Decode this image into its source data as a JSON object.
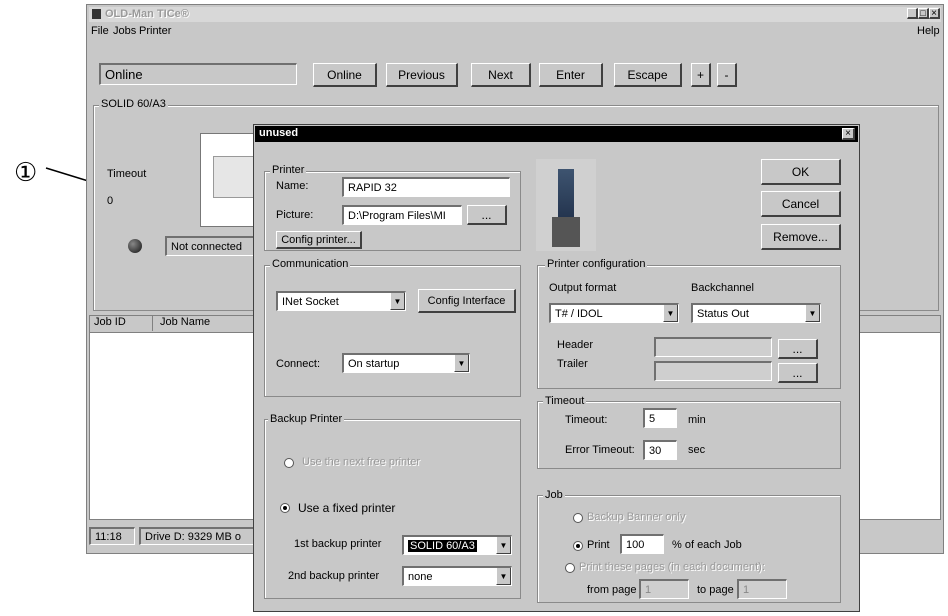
{
  "annotation": {
    "marker": "①"
  },
  "main_window": {
    "title": "OLD-Man TICe®",
    "controls": {
      "minimize": "_",
      "maximize": "□",
      "close": "×"
    },
    "menu": [
      "File",
      "Jobs",
      "Printer"
    ],
    "help_menu": "Help",
    "status_field": "Online",
    "toolbar": [
      "Online",
      "Previous",
      "Next",
      "Enter",
      "Escape",
      "+",
      "-"
    ],
    "printer_panel": {
      "title": "SOLID 60/A3",
      "timeout_label": "Timeout",
      "timeout_value": "0",
      "connection_status": "Not connected"
    },
    "job_list": {
      "columns": [
        "Job ID",
        "Job Name"
      ]
    },
    "statusbar": {
      "time": "11:18",
      "drive": "Drive D: 9329 MB o"
    }
  },
  "dialog": {
    "title": "unused",
    "close": "×",
    "printer_group": {
      "title": "Printer",
      "name_label": "Name:",
      "name_value": "RAPID 32",
      "picture_label": "Picture:",
      "picture_value": "D:\\Program Files\\MI",
      "browse": "...",
      "config_button": "Config printer..."
    },
    "buttons": {
      "ok": "OK",
      "cancel": "Cancel",
      "remove": "Remove..."
    },
    "communication_group": {
      "title": "Communication",
      "interface_value": "INet Socket",
      "config_button": "Config Interface",
      "connect_label": "Connect:",
      "connect_value": "On startup"
    },
    "printer_config_group": {
      "title": "Printer configuration",
      "output_format_label": "Output format",
      "output_format_value": "T# / IDOL",
      "backchannel_label": "Backchannel",
      "backchannel_value": "Status Out",
      "header_label": "Header",
      "trailer_label": "Trailer",
      "browse": "..."
    },
    "timeout_group": {
      "title": "Timeout",
      "timeout_label": "Timeout:",
      "timeout_value": "5",
      "timeout_unit": "min",
      "error_timeout_label": "Error Timeout:",
      "error_timeout_value": "30",
      "error_timeout_unit": "sec"
    },
    "backup_group": {
      "title": "Backup Printer",
      "option_next_free": "Use the next free printer",
      "option_fixed": "Use a fixed printer",
      "first_label": "1st backup printer",
      "first_value": "SOLID 60/A3",
      "second_label": "2nd backup printer",
      "second_value": "none"
    },
    "job_group": {
      "title": "Job",
      "option_banner": "Backup Banner only",
      "option_print": "Print",
      "print_value": "100",
      "print_suffix": "% of each Job",
      "option_pages": "Print these pages (in each document):",
      "from_label": "from page",
      "from_value": "1",
      "to_label": "to page",
      "to_value": "1"
    }
  }
}
